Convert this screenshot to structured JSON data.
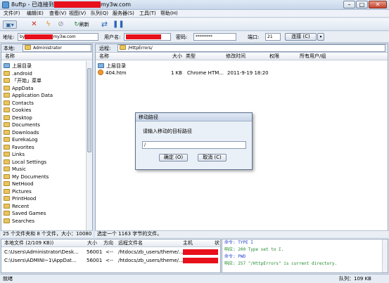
{
  "window": {
    "title_prefix": "8uftp - 已连接到",
    "title_suffix": "my3w.com"
  },
  "menu": [
    "文件(F)",
    "编辑(E)",
    "查看(V)",
    "视图(V)",
    "队列(Q)",
    "服务器(S)",
    "工具(T)",
    "帮助(H)"
  ],
  "toolbar": {
    "refresh_label": "刷新"
  },
  "connection": {
    "address_label": "地址:",
    "address_prefix": "by",
    "address_suffix": "my3w.com",
    "user_label": "用户名:",
    "password_label": "密码:",
    "password_value": "********",
    "port_label": "端口:",
    "port_value": "21",
    "connect_label": "连接 (C)"
  },
  "local": {
    "path_label": "本地:",
    "path_value": "Administrator",
    "col_name": "名称",
    "items": [
      "上层目录",
      ".android",
      "「开始」菜单",
      "AppData",
      "Application Data",
      "Contacts",
      "Cookies",
      "Desktop",
      "Documents",
      "Downloads",
      "EurekaLog",
      "Favorites",
      "Links",
      "Local Settings",
      "Music",
      "My Documents",
      "NetHood",
      "Pictures",
      "PrintHood",
      "Recent",
      "Saved Games",
      "Searches"
    ],
    "status": "25 个文件夹和 8 个文件，大小：10080"
  },
  "remote": {
    "path_label": "远程:",
    "path_value": "/HttpErrors/",
    "columns": [
      "名称",
      "大小",
      "类型",
      "修改时间",
      "权限",
      "所有用户/组"
    ],
    "files": [
      {
        "name": "上层目录",
        "size": "",
        "type": "",
        "modified": "",
        "kind": "up"
      },
      {
        "name": "404.htm",
        "size": "1 KB",
        "type": "Chrome HTM...",
        "modified": "2011-9-19 18:20",
        "kind": "htm"
      }
    ],
    "status": "选定一个 1163 字节的文件。"
  },
  "dialog": {
    "title": "移动路径",
    "prompt": "请输入移动的目标路径",
    "input_value": "/",
    "ok_label": "确定 (O)",
    "cancel_label": "取消 (C)"
  },
  "queue": {
    "columns": [
      "本地文件 (2/109 KB))",
      "大小",
      "方向",
      "远程文件名",
      "主机",
      "状"
    ],
    "rows": [
      {
        "local": "C:\\Users\\Administrator\\Desk...",
        "size": "56001",
        "dir": "<--",
        "remote": "/htdocs/zb_users/theme/..."
      },
      {
        "local": "C:\\Users\\ADMINI~1\\AppDat...",
        "size": "56001",
        "dir": "<--",
        "remote": "/htdocs/zb_users/theme/..."
      }
    ]
  },
  "log": [
    {
      "tag": "命令:",
      "text": "TYPE I",
      "kind": "cmd"
    },
    {
      "tag": "响应:",
      "text": "200 Type set to I.",
      "kind": "resp"
    },
    {
      "tag": "命令:",
      "text": "PWD",
      "kind": "cmd"
    },
    {
      "tag": "响应:",
      "text": "257 \"/HttpErrors\" is current directory.",
      "kind": "resp"
    }
  ],
  "statusbar": {
    "left": "就绪",
    "right": "队列：109 KB"
  }
}
